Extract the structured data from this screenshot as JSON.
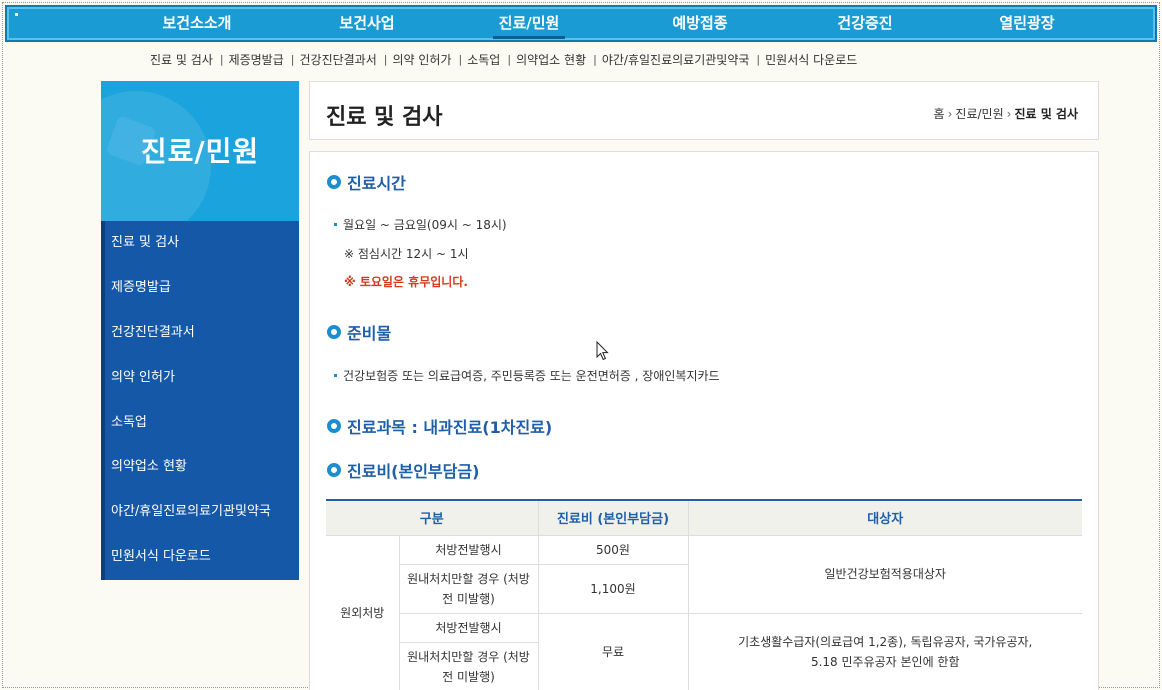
{
  "topnav": {
    "items": [
      "보건소소개",
      "보건사업",
      "진료/민원",
      "예방접종",
      "건강증진",
      "열린광장"
    ],
    "active_index": 2
  },
  "subnav": {
    "items": [
      "진료 및 검사",
      "제증명발급",
      "건강진단결과서",
      "의약 인허가",
      "소독업",
      "의약업소 현황",
      "야간/휴일진료의료기관및약국",
      "민원서식 다운로드"
    ]
  },
  "sidebar": {
    "title": "진료/민원",
    "items": [
      "진료 및 검사",
      "제증명발급",
      "건강진단결과서",
      "의약 인허가",
      "소독업",
      "의약업소 현황",
      "야간/휴일진료의료기관및약국",
      "민원서식 다운로드"
    ]
  },
  "page": {
    "title": "진료 및 검사",
    "breadcrumb": [
      "홈",
      "진료/민원",
      "진료 및 검사"
    ]
  },
  "sections": {
    "hours": {
      "title": "진료시간",
      "line": "월요일 ~ 금요일(09시 ~ 18시)",
      "note": "※ 점심시간 12시 ~ 1시",
      "note_red": "※ 토요일은 휴무입니다."
    },
    "prep": {
      "title": "준비물",
      "line": "건강보험증 또는 의료급여증, 주민등록증 또는 운전면허증 , 장애인복지카드"
    },
    "dept": {
      "title": "진료과목 : 내과진료(1차진료)"
    },
    "fee": {
      "title": "진료비(본인부담금)",
      "headers": [
        "구분",
        "진료비 (본인부담금)",
        "대상자"
      ],
      "group": "원외처방",
      "rows": [
        {
          "type": "처방전발행시",
          "fee": "500원"
        },
        {
          "type": "원내처치만할 경우 (처방전 미발행)",
          "fee": "1,100원"
        },
        {
          "type": "처방전발행시",
          "fee": "무료"
        },
        {
          "type": "원내처치만할 경우 (처방전 미발행)"
        }
      ],
      "target1": "일반건강보험적용대상자",
      "target2": "기초생활수급자(의료급여 1,2종), 독립유공자, 국가유공자, 5.18 민주유공자 본인에 한함"
    }
  },
  "icons": {
    "cursor": "mouse-pointer-icon",
    "section": "ring-bullet-icon"
  },
  "colors": {
    "nav": "#1a9bd4",
    "sidebar": "#1558a8",
    "accent": "#1f5fa9",
    "warn": "#d9381e"
  }
}
